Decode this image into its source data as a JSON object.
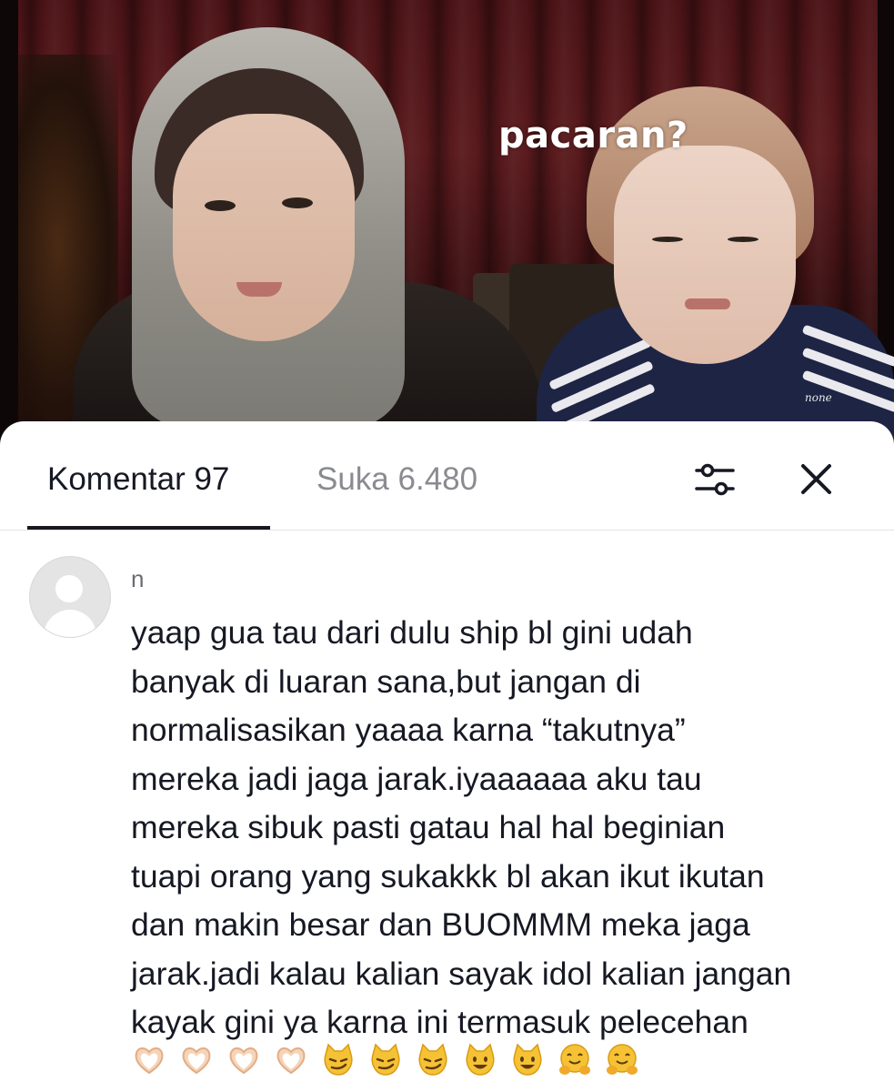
{
  "video": {
    "caption": "pacaran?",
    "watermark": "none"
  },
  "comments_sheet": {
    "tabs": [
      {
        "label": "Komentar 97",
        "active": true
      },
      {
        "label": "Suka 6.480",
        "active": false
      }
    ],
    "icons": {
      "filter": "sliders-icon",
      "close": "close-icon"
    },
    "comment": {
      "username": "n",
      "text": "yaap gua tau dari dulu ship bl gini udah\nbanyak di luaran sana,but jangan di\nnormalisasikan yaaaa karna “takutnya”\nmereka jadi jaga jarak.iyaaaaaa aku tau\nmereka sibuk pasti gatau hal hal beginian\ntuapi orang yang sukakkk bl akan ikut ikutan\ndan makin besar dan BUOMMM meka jaga\njarak.jadi kalau kalian sayak idol kalian jangan\nkayak gini ya karna ini termasuk pelecehan",
      "emojis": [
        "heart-hands",
        "heart-hands",
        "heart-hands",
        "heart-hands",
        "smirk-cat",
        "smirk-cat",
        "smirk-cat",
        "smiley-cat",
        "smiley-cat",
        "hugging-face",
        "hugging-face"
      ]
    }
  },
  "colors": {
    "text_primary": "#161823",
    "text_secondary": "#8a8b91",
    "divider": "#e3e3e4"
  }
}
